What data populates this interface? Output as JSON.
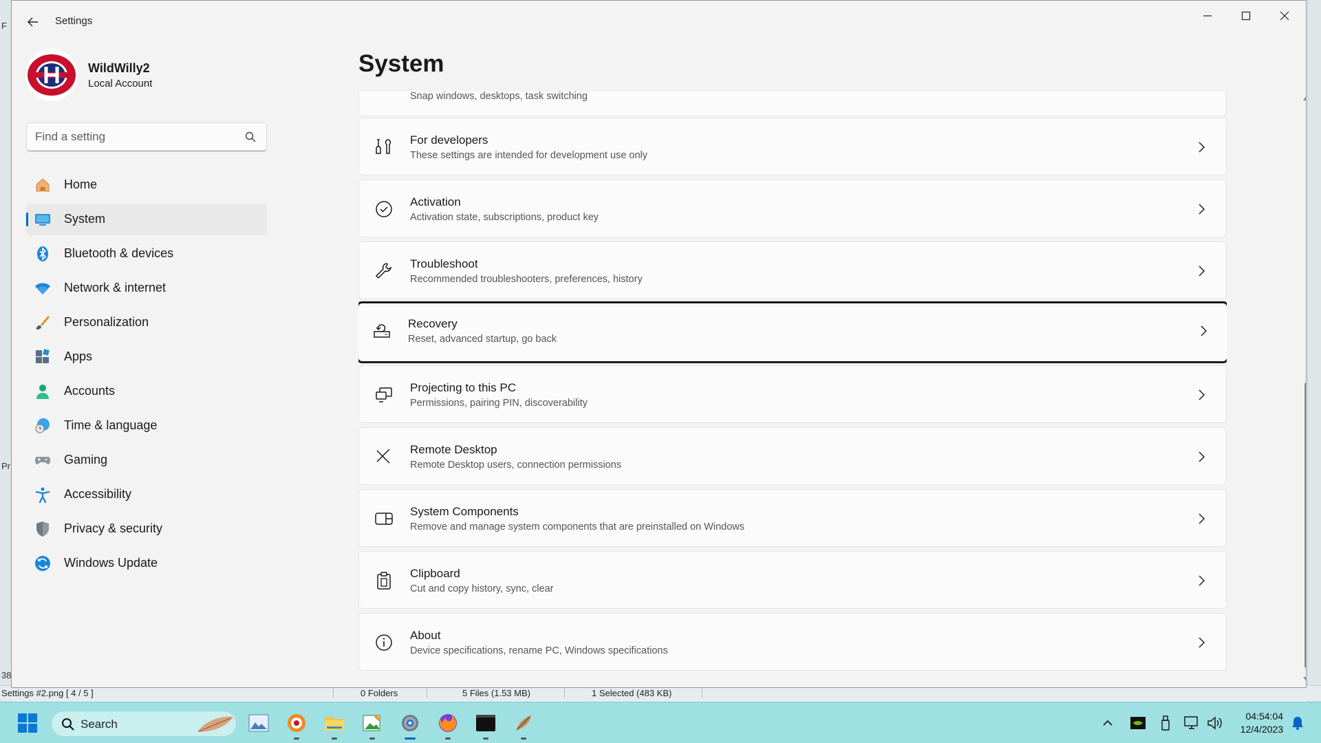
{
  "background_app": {
    "left_fragments": [
      "F",
      "Pr",
      "38"
    ],
    "status": {
      "filename": "Settings #2.png [ 4 / 5 ]",
      "folders": "0 Folders",
      "files": "5 Files (1.53 MB)",
      "selected": "1 Selected (483 KB)"
    }
  },
  "window": {
    "app_title": "Settings",
    "controls": {
      "minimize": "—",
      "maximize": "☐",
      "close": "✕"
    }
  },
  "profile": {
    "name": "WildWilly2",
    "account_type": "Local Account"
  },
  "search": {
    "placeholder": "Find a setting"
  },
  "nav": {
    "items": [
      {
        "label": "Home",
        "icon": "home-icon"
      },
      {
        "label": "System",
        "icon": "system-icon",
        "active": true
      },
      {
        "label": "Bluetooth & devices",
        "icon": "bluetooth-icon"
      },
      {
        "label": "Network & internet",
        "icon": "wifi-icon"
      },
      {
        "label": "Personalization",
        "icon": "brush-icon"
      },
      {
        "label": "Apps",
        "icon": "apps-icon"
      },
      {
        "label": "Accounts",
        "icon": "person-icon"
      },
      {
        "label": "Time & language",
        "icon": "clock-globe-icon"
      },
      {
        "label": "Gaming",
        "icon": "gamepad-icon"
      },
      {
        "label": "Accessibility",
        "icon": "accessibility-icon"
      },
      {
        "label": "Privacy & security",
        "icon": "shield-icon"
      },
      {
        "label": "Windows Update",
        "icon": "update-icon"
      }
    ]
  },
  "main": {
    "title": "System",
    "partial_card_desc": "Snap windows, desktops, task switching",
    "cards": [
      {
        "title": "For developers",
        "desc": "These settings are intended for development use only",
        "icon": "developer-tools-icon"
      },
      {
        "title": "Activation",
        "desc": "Activation state, subscriptions, product key",
        "icon": "check-circle-icon"
      },
      {
        "title": "Troubleshoot",
        "desc": "Recommended troubleshooters, preferences, history",
        "icon": "wrench-icon"
      },
      {
        "title": "Recovery",
        "desc": "Reset, advanced startup, go back",
        "icon": "recovery-icon",
        "focused": true
      },
      {
        "title": "Projecting to this PC",
        "desc": "Permissions, pairing PIN, discoverability",
        "icon": "projecting-icon"
      },
      {
        "title": "Remote Desktop",
        "desc": "Remote Desktop users, connection permissions",
        "icon": "remote-desktop-icon"
      },
      {
        "title": "System Components",
        "desc": "Remove and manage system components that are preinstalled on Windows",
        "icon": "components-icon"
      },
      {
        "title": "Clipboard",
        "desc": "Cut and copy history, sync, clear",
        "icon": "clipboard-icon"
      },
      {
        "title": "About",
        "desc": "Device specifications, rename PC, Windows specifications",
        "icon": "info-icon"
      }
    ]
  },
  "taskbar": {
    "search_label": "Search",
    "time": "04:54:04",
    "date": "12/4/2023"
  },
  "colors": {
    "accent": "#0067c0",
    "taskbar": "#9fe0e2",
    "window_bg": "#f3f3f3",
    "card_bg": "#fbfbfb"
  }
}
